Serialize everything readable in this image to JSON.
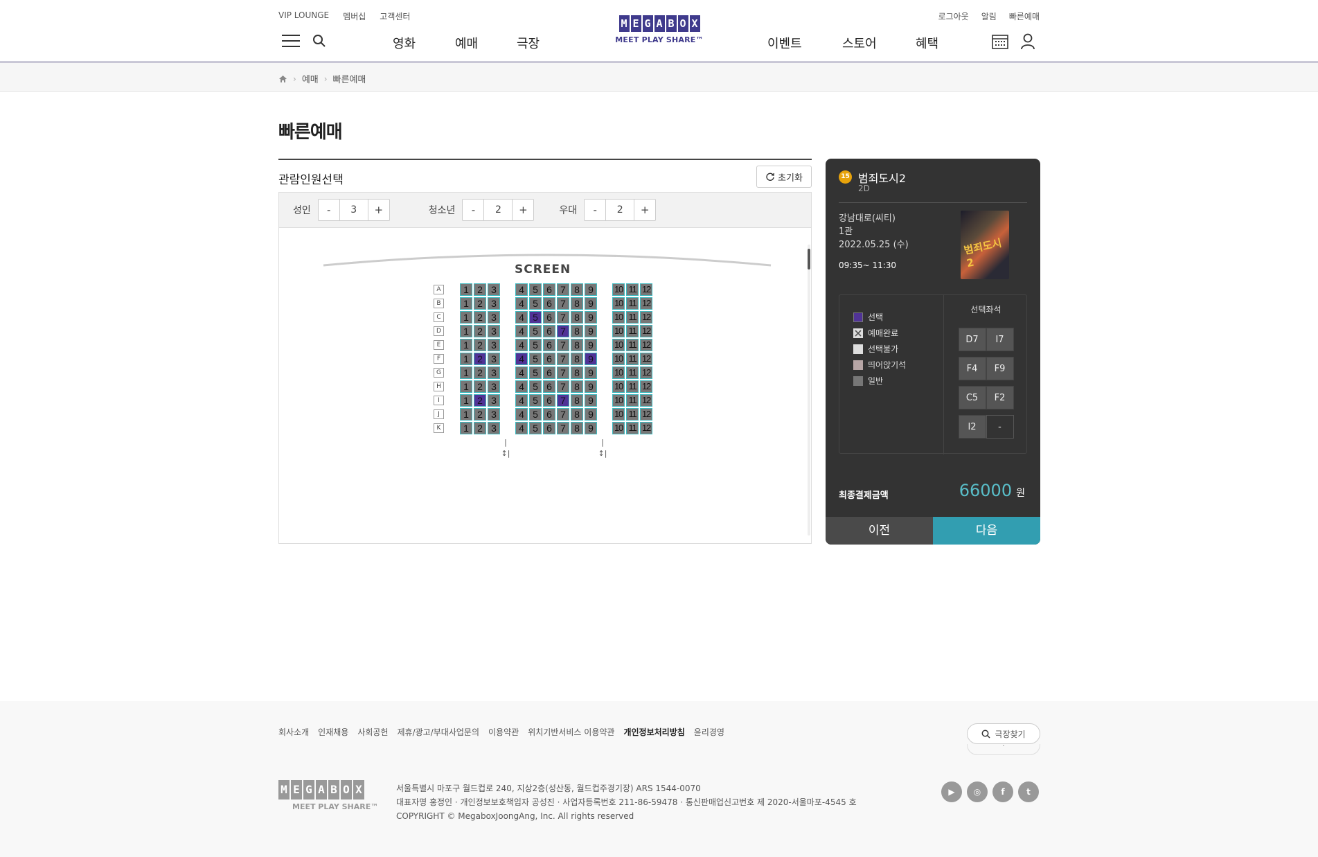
{
  "header": {
    "util_left": [
      "VIP LOUNGE",
      "멤버십",
      "고객센터"
    ],
    "util_right": [
      "로그아웃",
      "알림",
      "빠른예매"
    ],
    "nav_left": [
      "영화",
      "예매",
      "극장"
    ],
    "nav_right": [
      "이벤트",
      "스토어",
      "혜택"
    ],
    "logo_letters": [
      "M",
      "E",
      "G",
      "A",
      "B",
      "O",
      "X"
    ],
    "logo_sub": "MEET PLAY SHARE™"
  },
  "breadcrumb": [
    "예매",
    "빠른예매"
  ],
  "page_title": "빠른예매",
  "people": {
    "section_title": "관람인원선택",
    "reset_label": "초기화",
    "groups": [
      {
        "label": "성인",
        "minus": "-",
        "value": "3",
        "plus": "+"
      },
      {
        "label": "청소년",
        "minus": "-",
        "value": "2",
        "plus": "+"
      },
      {
        "label": "우대",
        "minus": "-",
        "value": "2",
        "plus": "+"
      }
    ]
  },
  "seatmap": {
    "screen_label": "SCREEN",
    "rows": [
      "A",
      "B",
      "C",
      "D",
      "E",
      "F",
      "G",
      "H",
      "I",
      "J",
      "K"
    ],
    "selected": [
      "C5",
      "D7",
      "F2",
      "F4",
      "F9",
      "I2",
      "I7"
    ],
    "aisle_mark": "|↕|"
  },
  "summary": {
    "age_rating": "15",
    "movie_title": "범죄도시2",
    "format": "2D",
    "theater": "강남대로(씨티)",
    "hall": "1관",
    "date": "2022.05.25 (수)",
    "time": "09:35~ 11:30",
    "poster_text": "범죄도시2",
    "legend": [
      {
        "label": "선택",
        "color": "#503396"
      },
      {
        "label": "예매완료",
        "color": "#dddddd"
      },
      {
        "label": "선택불가",
        "color": "#dddddd"
      },
      {
        "label": "띄어앉기석",
        "color": "#b7a6a6"
      },
      {
        "label": "일반",
        "color": "#777777"
      }
    ],
    "selected_title": "선택좌석",
    "selected_seats": [
      "D7",
      "I7",
      "F4",
      "F9",
      "C5",
      "F2",
      "I2",
      "-"
    ],
    "total_label": "최종결제금액",
    "total_amount": "66000",
    "total_unit": "원",
    "prev_label": "이전",
    "next_label": "다음"
  },
  "footer": {
    "links": [
      "회사소개",
      "인재채용",
      "사회공헌",
      "제휴/광고/부대사업문의",
      "이용약관",
      "위치기반서비스 이용약관",
      "개인정보처리방침",
      "윤리경영"
    ],
    "find_theater": "극장찾기",
    "find_under": "·",
    "logo_letters": [
      "M",
      "E",
      "G",
      "A",
      "B",
      "O",
      "X"
    ],
    "logo_sub": "MEET PLAY SHARE™",
    "address_lines": [
      "서울특별시 마포구 월드컵로 240, 지상2층(성산동, 월드컵주경기장) ARS 1544-0070",
      "대표자명 홍정인 · 개인정보보호책임자 공성진 · 사업자등록번호 211-86-59478 · 통신판매업신고번호 제 2020-서울마포-4545 호",
      "COPYRIGHT © MegaboxJoongAng, Inc. All rights reserved"
    ],
    "sns": [
      "youtube-icon",
      "instagram-icon",
      "facebook-icon",
      "twitter-icon"
    ]
  }
}
